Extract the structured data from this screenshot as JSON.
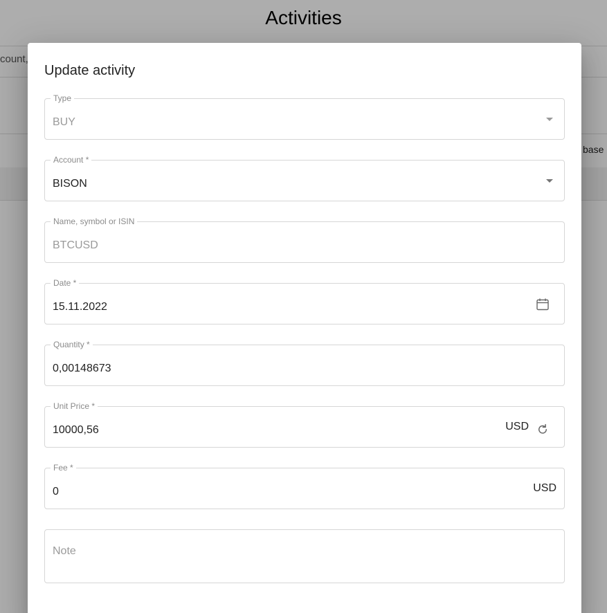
{
  "background": {
    "page_title": "Activities",
    "filter_fragment": "count,",
    "header_fragment": "base"
  },
  "dialog": {
    "title": "Update activity",
    "fields": {
      "type": {
        "label": "Type",
        "value": "BUY",
        "icon": "dropdown-arrow"
      },
      "account": {
        "label": "Account *",
        "value": "BISON",
        "icon": "dropdown-arrow"
      },
      "symbol": {
        "label": "Name, symbol or ISIN",
        "value": "BTCUSD"
      },
      "date": {
        "label": "Date *",
        "value": "15.11.2022",
        "icon": "calendar-icon"
      },
      "quantity": {
        "label": "Quantity *",
        "value": "0,00148673"
      },
      "unit_price": {
        "label": "Unit Price *",
        "value": "10000,56",
        "currency": "USD",
        "icon": "refresh-icon"
      },
      "fee": {
        "label": "Fee *",
        "value": "0",
        "currency": "USD"
      },
      "note": {
        "placeholder": "Note",
        "value": ""
      }
    }
  },
  "colors": {
    "overlay": "#000000",
    "field_border": "#d6d6d6",
    "label_text": "#8a8a8a",
    "disabled_text": "#9a9a9a",
    "primary_text": "#222222"
  }
}
